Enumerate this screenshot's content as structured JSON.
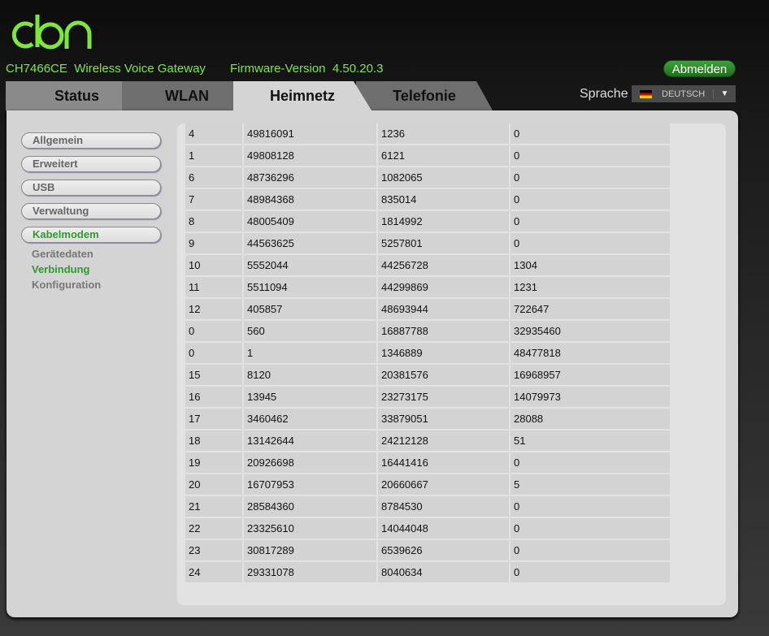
{
  "header": {
    "logo": "cbn",
    "model": "CH7466CE  Wireless Voice Gateway",
    "firmware": "Firmware-Version  4.50.20.3",
    "logout": "Abmelden",
    "language_label": "Sprache",
    "language": "DEUTSCH"
  },
  "tabs": [
    "Status",
    "WLAN",
    "Heimnetz",
    "Telefonie"
  ],
  "active_tab": "Heimnetz",
  "sidebar": {
    "items": [
      "Allgemein",
      "Erweitert",
      "USB",
      "Verwaltung",
      "Kabelmodem"
    ],
    "sub_items": [
      "Gerätedaten",
      "Verbindung",
      "Konfiguration"
    ],
    "active": "Kabelmodem",
    "active_sub": "Verbindung"
  },
  "table": {
    "rows": [
      [
        "4",
        "49816091",
        "1236",
        "0"
      ],
      [
        "1",
        "49808128",
        "6121",
        "0"
      ],
      [
        "6",
        "48736296",
        "1082065",
        "0"
      ],
      [
        "7",
        "48984368",
        "835014",
        "0"
      ],
      [
        "8",
        "48005409",
        "1814992",
        "0"
      ],
      [
        "9",
        "44563625",
        "5257801",
        "0"
      ],
      [
        "10",
        "5552044",
        "44256728",
        "1304"
      ],
      [
        "11",
        "5511094",
        "44299869",
        "1231"
      ],
      [
        "12",
        "405857",
        "48693944",
        "722647"
      ],
      [
        "0",
        "560",
        "16887788",
        "32935460"
      ],
      [
        "0",
        "1",
        "1346889",
        "48477818"
      ],
      [
        "15",
        "8120",
        "20381576",
        "16968957"
      ],
      [
        "16",
        "13945",
        "23273175",
        "14079973"
      ],
      [
        "17",
        "3460462",
        "33879051",
        "28088"
      ],
      [
        "18",
        "13142644",
        "24212128",
        "51"
      ],
      [
        "19",
        "20926698",
        "16441416",
        "0"
      ],
      [
        "20",
        "16707953",
        "20660667",
        "5"
      ],
      [
        "21",
        "28584360",
        "8784530",
        "0"
      ],
      [
        "22",
        "23325610",
        "14044048",
        "0"
      ],
      [
        "23",
        "30817289",
        "6539626",
        "0"
      ],
      [
        "24",
        "29331078",
        "8040634",
        "0"
      ]
    ]
  },
  "colors": {
    "accent": "#7ee83a",
    "active_nav": "#2e9a2e"
  }
}
